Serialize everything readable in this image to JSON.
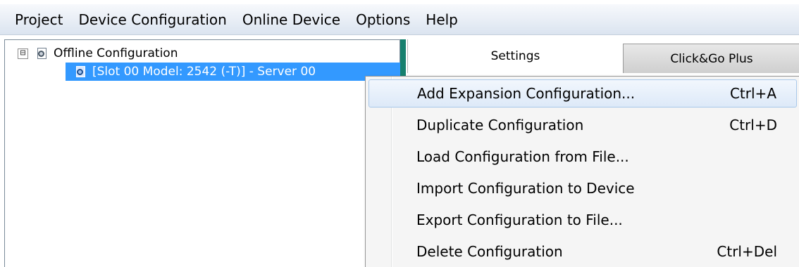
{
  "menubar": {
    "items": [
      "Project",
      "Device Configuration",
      "Online Device",
      "Options",
      "Help"
    ]
  },
  "tree": {
    "root": {
      "label": "Offline Configuration",
      "expander": "⊟"
    },
    "child": {
      "label": "[Slot 00 Model: 2542 (-T)] - Server 00",
      "selected": true
    }
  },
  "tabs": [
    {
      "label": "Settings",
      "active": true
    },
    {
      "label": "Click&Go Plus",
      "active": false
    }
  ],
  "context_menu": {
    "items": [
      {
        "label": "Add Expansion Configuration...",
        "shortcut": "Ctrl+A",
        "highlighted": true
      },
      {
        "label": "Duplicate Configuration",
        "shortcut": "Ctrl+D"
      },
      {
        "label": "Load Configuration from File...",
        "shortcut": ""
      },
      {
        "label": "Import Configuration to Device",
        "shortcut": ""
      },
      {
        "label": "Export Configuration to File...",
        "shortcut": ""
      },
      {
        "label": "Delete Configuration",
        "shortcut": "Ctrl+Del"
      }
    ]
  },
  "colors": {
    "selection": "#3399ff",
    "splitter": "#17806e",
    "menu_highlight_border": "#a8c8ea"
  },
  "icons": {
    "tree_node": "config-page-gear-icon",
    "expander": "collapse-minus-icon"
  }
}
